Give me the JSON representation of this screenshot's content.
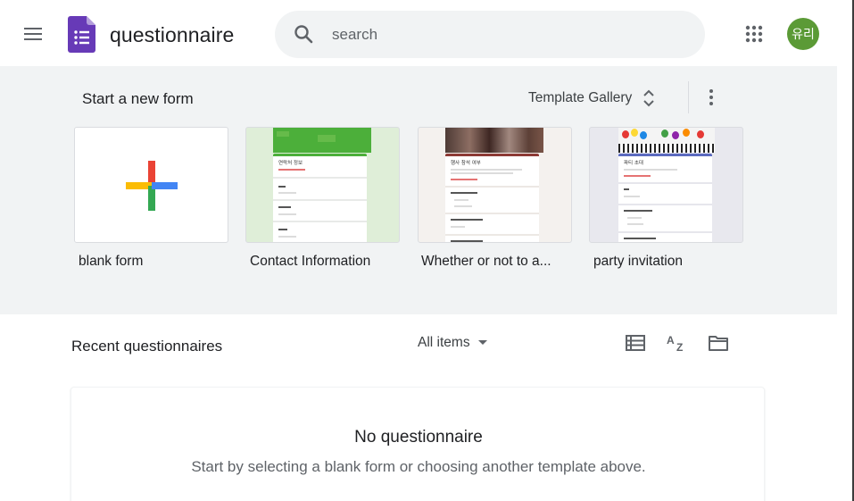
{
  "header": {
    "app_title": "questionnaire",
    "search_placeholder": "search",
    "avatar_text": "유리",
    "avatar_color": "#5b9a36",
    "brand_color": "#673ab7"
  },
  "templates": {
    "section_title": "Start a new form",
    "gallery_label": "Template Gallery",
    "items": [
      {
        "label": "blank form",
        "icon": "plus-icon"
      },
      {
        "label": "Contact Information",
        "header_text": "연락처 정보"
      },
      {
        "label": "Whether or not to a...",
        "header_text": "행사 참석 여부"
      },
      {
        "label": "party invitation",
        "header_text": "파티 초대"
      }
    ]
  },
  "recent": {
    "title": "Recent questionnaires",
    "filter_label": "All items"
  },
  "empty_state": {
    "title": "No questionnaire",
    "subtitle": "Start by selecting a blank form or choosing another template above."
  }
}
